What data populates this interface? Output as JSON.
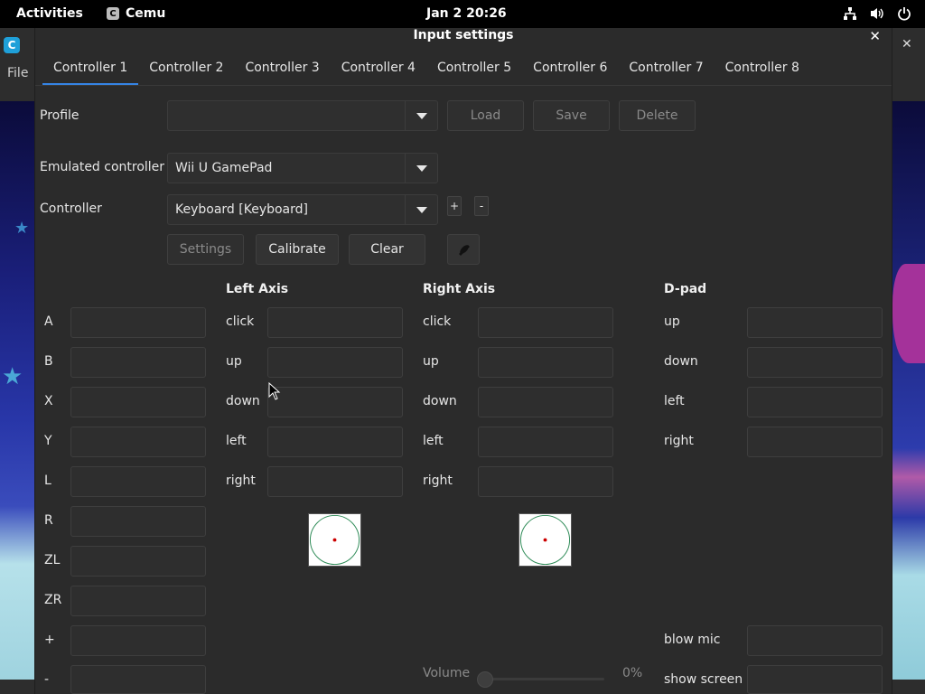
{
  "topbar": {
    "activities": "Activities",
    "app_name": "Cemu",
    "app_icon_glyph": "C",
    "clock": "Jan 2  20:26",
    "tray_icons": [
      "network-icon",
      "volume-icon",
      "power-icon"
    ]
  },
  "background_app": {
    "logo_glyph": "C",
    "file_menu": "File",
    "close_glyph": "✕"
  },
  "dialog": {
    "title": "Input settings",
    "close_glyph": "✕",
    "tabs": [
      "Controller 1",
      "Controller 2",
      "Controller 3",
      "Controller 4",
      "Controller 5",
      "Controller 6",
      "Controller 7",
      "Controller 8"
    ],
    "active_tab": 0,
    "profile": {
      "label": "Profile",
      "value": "",
      "load": "Load",
      "save": "Save",
      "delete": "Delete"
    },
    "emulated": {
      "label": "Emulated controller",
      "value": "Wii U GamePad"
    },
    "controller": {
      "label": "Controller",
      "value": "Keyboard [Keyboard]",
      "add": "+",
      "remove": "-"
    },
    "actions": {
      "settings": "Settings",
      "calibrate": "Calibrate",
      "clear": "Clear"
    },
    "buttons_column": {
      "labels": [
        "A",
        "B",
        "X",
        "Y",
        "L",
        "R",
        "ZL",
        "ZR",
        "+",
        "-"
      ]
    },
    "left_axis": {
      "title": "Left Axis",
      "labels": [
        "click",
        "up",
        "down",
        "left",
        "right"
      ]
    },
    "right_axis": {
      "title": "Right Axis",
      "labels": [
        "click",
        "up",
        "down",
        "left",
        "right"
      ]
    },
    "dpad": {
      "title": "D-pad",
      "labels": [
        "up",
        "down",
        "left",
        "right"
      ]
    },
    "extra": {
      "blow_mic": "blow mic",
      "show_screen": "show screen"
    },
    "volume": {
      "label": "Volume",
      "value_text": "0%",
      "value": 0
    }
  },
  "colors": {
    "accent": "#3584e4",
    "stick_dot": "#cc0000",
    "stick_ring": "#2e8b57"
  }
}
